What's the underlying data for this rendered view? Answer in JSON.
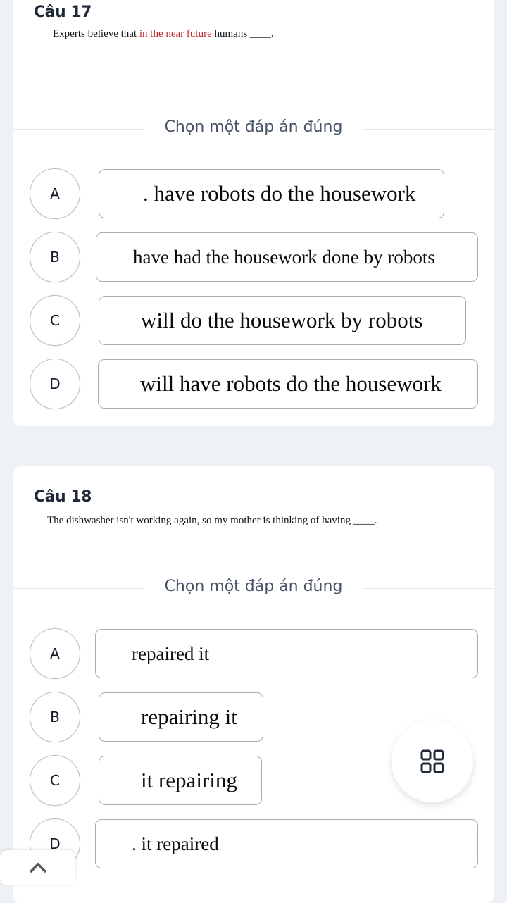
{
  "choose_label": "Chọn một đáp án đúng",
  "questions": [
    {
      "title": "Câu 17",
      "text_before": "Experts believe that ",
      "text_highlight": "in the near future",
      "text_after": " humans ____.",
      "highlight_color": "#c0272d",
      "options": [
        {
          "letter": "A",
          "text": ". have robots do the housework"
        },
        {
          "letter": "B",
          "text": "have had the housework done by robots"
        },
        {
          "letter": "C",
          "text": "will do the housework by robots"
        },
        {
          "letter": "D",
          "text": "will have robots do the housework"
        }
      ]
    },
    {
      "title": "Câu 18",
      "text_before": "The dishwasher isn't working again, so my mother is thinking of having ____.",
      "options": [
        {
          "letter": "A",
          "text": "repaired it"
        },
        {
          "letter": "B",
          "text": "repairing it"
        },
        {
          "letter": "C",
          "text": "it repairing"
        },
        {
          "letter": "D",
          "text": ". it repaired"
        }
      ]
    }
  ],
  "fab": {
    "icon": "grid-icon"
  },
  "scroll_up": {
    "icon": "chevron-up-icon"
  }
}
